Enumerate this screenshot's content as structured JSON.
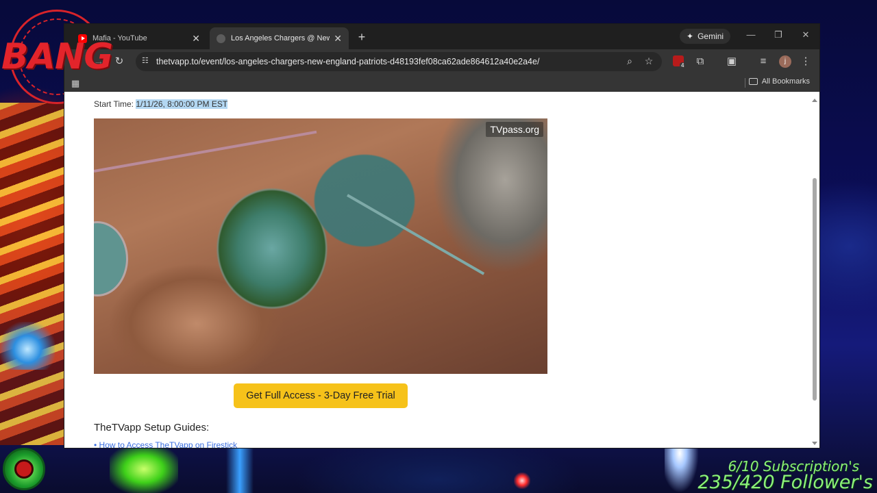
{
  "overlay": {
    "stamp_text": "BANG",
    "followers_line1": "6/10 Subscription's",
    "followers_line2": "235/420 Follower's"
  },
  "browser": {
    "tabs": [
      {
        "title": "Mafia - YouTube",
        "icon": "youtube-icon"
      },
      {
        "title": "Los Angeles Chargers @ New E",
        "icon": "globe-icon"
      }
    ],
    "gemini_label": "Gemini",
    "url": "thetvapp.to/event/los-angeles-chargers-new-england-patriots-d48193fef08ca62ade864612a40e2a4e/",
    "extension_badge": "4",
    "profile_initial": "j",
    "bookmarks_label": "All Bookmarks"
  },
  "page": {
    "start_time_label": "Start Time:",
    "start_time_value": "1/11/26, 8:00:00 PM EST",
    "video_watermark": "TVpass.org",
    "cta_label": "Get Full Access - 3-Day Free Trial",
    "guides_heading": "TheTVapp Setup Guides:",
    "guide_links": [
      "• How to Access TheTVapp on Firestick"
    ]
  },
  "colors": {
    "cta": "#f6c21a",
    "link": "#3a6ee0",
    "highlight": "#b3d7f2",
    "stamp": "#e3242b",
    "followers": "#8cf07a"
  }
}
